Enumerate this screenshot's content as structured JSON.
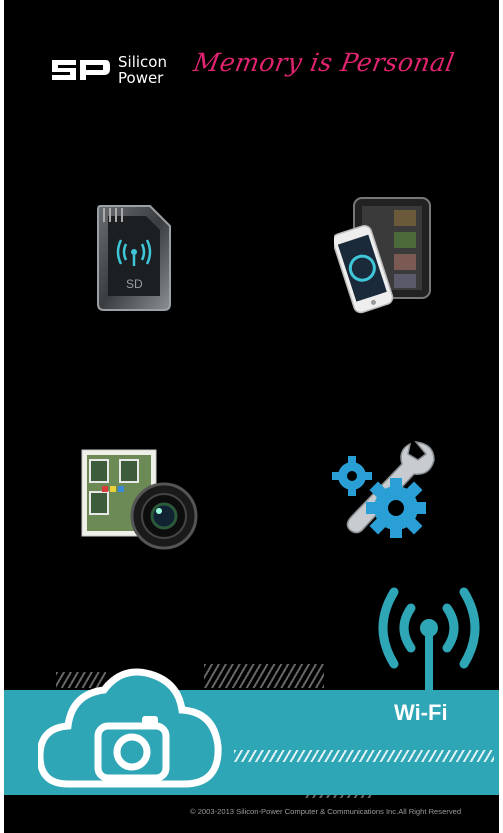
{
  "header": {
    "brand_short": "SP",
    "brand_line1": "Silicon",
    "brand_line2": "Power",
    "tagline": "Memory is Personal"
  },
  "tiles": [
    {
      "icon": "wifi-sd-card-icon",
      "sd_label": "SD"
    },
    {
      "icon": "tablet-phone-icon"
    },
    {
      "icon": "photo-camera-gallery-icon"
    },
    {
      "icon": "settings-tools-icon"
    }
  ],
  "banner": {
    "wifi_label": "Wi-Fi",
    "icon": "cloud-camera-icon"
  },
  "footer": {
    "copyright": "© 2003-2013 Silicon-Power Computer & Communications Inc.All Right Reserved"
  },
  "colors": {
    "background": "#000000",
    "accent_teal": "#2fa6b6",
    "tagline_pink": "#e0236f"
  }
}
